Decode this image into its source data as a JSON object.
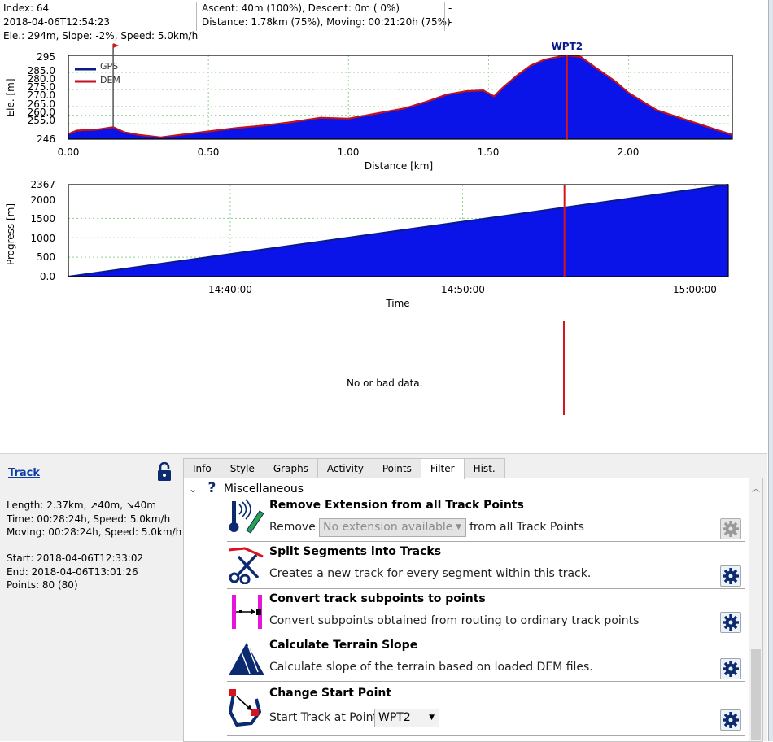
{
  "info": {
    "col1": [
      "Index: 64",
      "2018-04-06T12:54:23",
      "Ele.: 294m, Slope: -2%, Speed: 5.0km/h"
    ],
    "col2": [
      "Ascent: 40m (100%), Descent: 0m ( 0%)",
      "Distance: 1.78km (75%), Moving: 00:21:20h (75%)"
    ],
    "col3": [
      "-",
      "-"
    ]
  },
  "charts": {
    "elevation": {
      "ylabel": "Ele. [m]",
      "xlabel": "Distance [km]",
      "yticks": [
        "295",
        "285.0",
        "280.0",
        "275.0",
        "270.0",
        "265.0",
        "260.0",
        "255.0",
        "246"
      ],
      "xticks": [
        "0.00",
        "0.50",
        "1.00",
        "1.50",
        "2.00"
      ],
      "legend": [
        "GPS",
        "DEM"
      ],
      "marker_label": "WPT2"
    },
    "progress": {
      "ylabel": "Progress [m]",
      "xlabel": "Time",
      "yticks": [
        "2367",
        "2000",
        "1500",
        "1000",
        "500",
        "0.0"
      ],
      "xticks": [
        "14:40:00",
        "14:50:00",
        "15:00:00"
      ]
    },
    "third": {
      "message": "No or bad data."
    }
  },
  "chart_data": [
    {
      "type": "area",
      "x": [
        0.0,
        0.03,
        0.1,
        0.16,
        0.2,
        0.25,
        0.33,
        0.4,
        0.5,
        0.6,
        0.7,
        0.8,
        0.9,
        1.0,
        1.1,
        1.2,
        1.28,
        1.35,
        1.42,
        1.48,
        1.52,
        1.55,
        1.6,
        1.65,
        1.7,
        1.76,
        1.78,
        1.83,
        1.88,
        1.95,
        2.0,
        2.1,
        2.2,
        2.37
      ],
      "series": [
        {
          "name": "GPS",
          "values": [
            249,
            251,
            251.5,
            253,
            250,
            248.5,
            247,
            248.5,
            250.5,
            252.5,
            254,
            256,
            258.5,
            258,
            261,
            264,
            268,
            272,
            274,
            274.5,
            271,
            276,
            283,
            289,
            292.5,
            294.5,
            295,
            294,
            288,
            280,
            273,
            263,
            257.5,
            248.5
          ]
        },
        {
          "name": "DEM",
          "values": [
            249,
            251,
            251.5,
            253,
            250,
            248.5,
            247,
            248.5,
            250.5,
            252.5,
            254,
            256,
            258.5,
            258,
            261,
            264,
            268,
            272,
            274,
            274.5,
            271,
            276,
            283,
            289,
            292.5,
            294.5,
            295,
            294,
            288,
            280,
            273,
            263,
            257.5,
            248.5
          ]
        }
      ],
      "ylim": [
        246,
        295
      ],
      "xlim": [
        0,
        2.37
      ],
      "marker": {
        "label": "WPT2",
        "x": 1.78
      },
      "start_flag_x": 0.16
    },
    {
      "type": "area",
      "x": [
        "14:33:02",
        "15:01:26"
      ],
      "series": [
        {
          "values": [
            0,
            2367
          ]
        }
      ],
      "ylim": [
        0,
        2367
      ],
      "xlim": [
        "14:33:02",
        "15:01:26"
      ],
      "marker_x": "14:54:23"
    }
  ],
  "panel": {
    "track_link": "Track",
    "summary1": [
      "Length: 2.37km, ↗40m, ↘40m",
      "Time: 00:28:24h, Speed: 5.0km/h",
      "Moving: 00:28:24h, Speed: 5.0km/h"
    ],
    "summary2": [
      "Start: 2018-04-06T12:33:02",
      "End: 2018-04-06T13:01:26",
      "Points: 80 (80)"
    ],
    "tabs": [
      "Info",
      "Style",
      "Graphs",
      "Activity",
      "Points",
      "Filter",
      "Hist."
    ],
    "active_tab": "Filter",
    "group": "Miscellaneous",
    "items": [
      {
        "title": "Remove Extension from all Track Points",
        "prefix": "Remove",
        "combo": "No extension available",
        "suffix": "from all Track Points"
      },
      {
        "title": "Split Segments into Tracks",
        "desc": "Creates a new track for every segment within this track."
      },
      {
        "title": "Convert track subpoints to points",
        "desc": "Convert subpoints obtained from routing to ordinary track points"
      },
      {
        "title": "Calculate Terrain Slope",
        "desc": "Calculate slope of the terrain based on loaded DEM files."
      },
      {
        "title": "Change Start Point",
        "prefix": "Start Track at Point:",
        "combo": "WPT2"
      }
    ]
  },
  "colors": {
    "fill": "#0a14e8",
    "dem_line": "#c0121c",
    "gps_line": "#0a1a8a",
    "marker": "#d6141e",
    "link": "#0b3da9"
  }
}
